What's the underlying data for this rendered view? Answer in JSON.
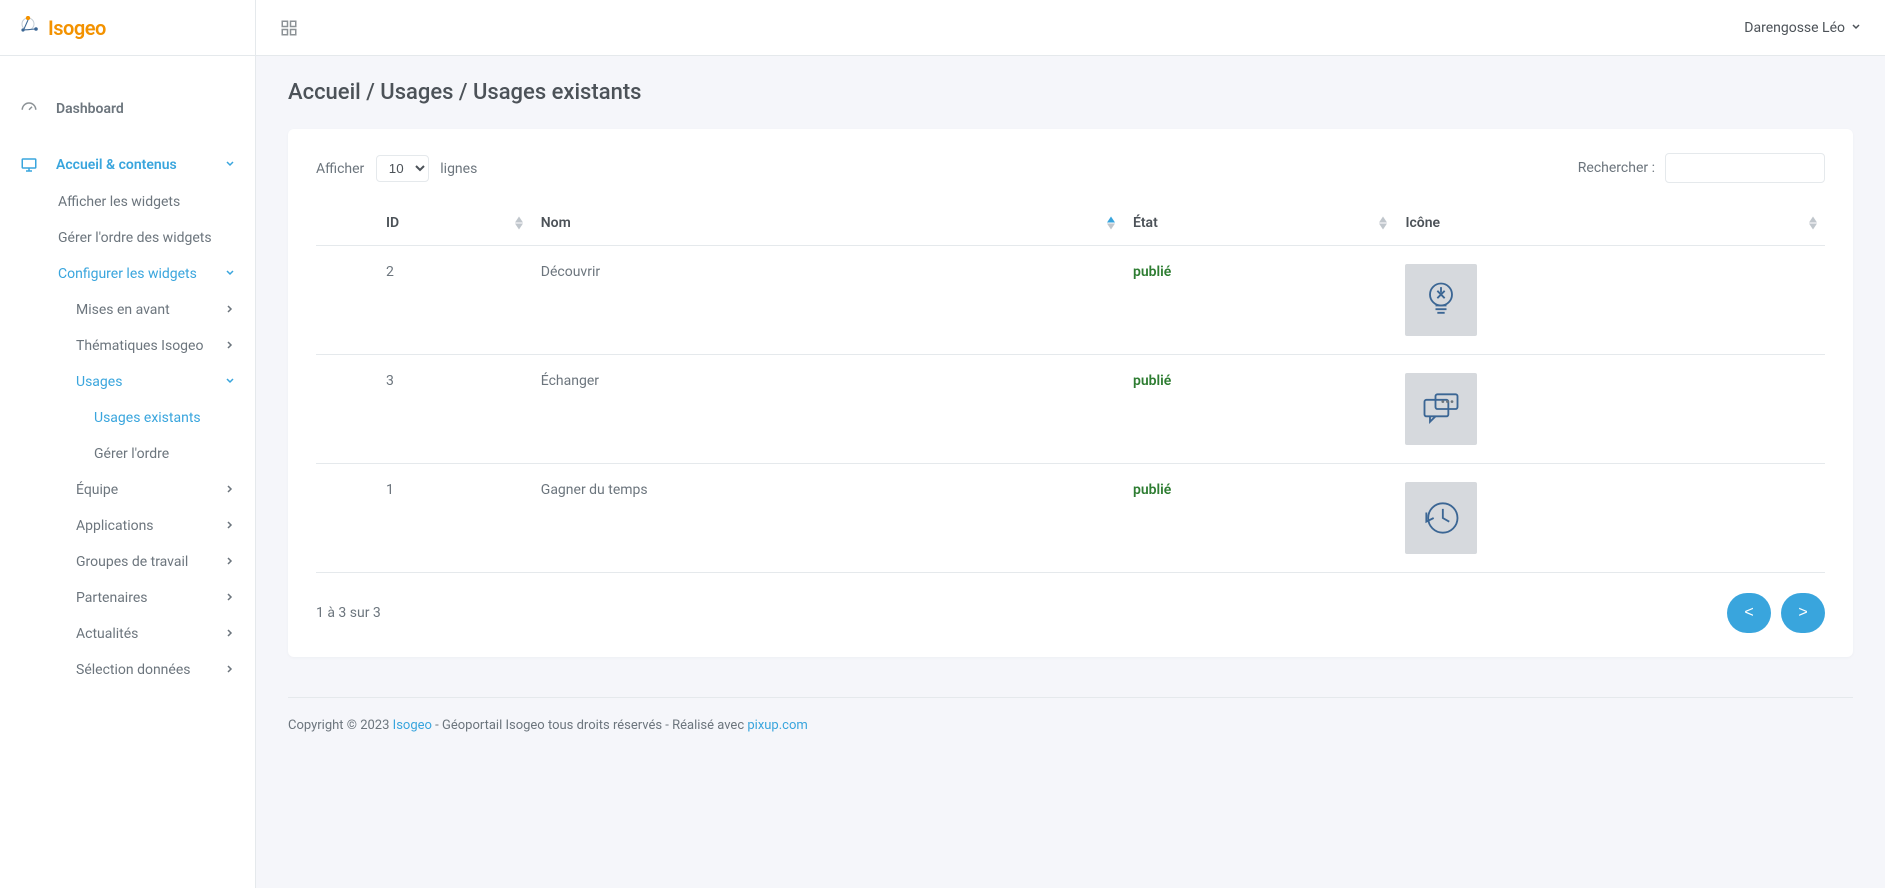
{
  "logo_text": "Isogeo",
  "topbar": {
    "user_name": "Darengosse Léo"
  },
  "sidebar": {
    "dashboard": "Dashboard",
    "accueil": "Accueil & contenus",
    "afficher_widgets": "Afficher les widgets",
    "gerer_ordre_widgets": "Gérer l'ordre des widgets",
    "configurer_widgets": "Configurer les widgets",
    "mises_en_avant": "Mises en avant",
    "thematiques_isogeo": "Thématiques Isogeo",
    "usages": "Usages",
    "usages_existants": "Usages existants",
    "gerer_ordre": "Gérer l'ordre",
    "equipe": "Équipe",
    "applications": "Applications",
    "groupes_travail": "Groupes de travail",
    "partenaires": "Partenaires",
    "actualites": "Actualités",
    "selection_donnees": "Sélection données"
  },
  "breadcrumb": "Accueil / Usages / Usages existants",
  "table": {
    "show_prefix": "Afficher",
    "show_suffix": "lignes",
    "page_size": "10",
    "search_label": "Rechercher :",
    "search_value": "",
    "cols": {
      "id": "ID",
      "nom": "Nom",
      "etat": "État",
      "icone": "Icône"
    },
    "rows": [
      {
        "id": "2",
        "nom": "Découvrir",
        "etat": "publié",
        "icon": "bulb"
      },
      {
        "id": "3",
        "nom": "Échanger",
        "etat": "publié",
        "icon": "chat"
      },
      {
        "id": "1",
        "nom": "Gagner du temps",
        "etat": "publié",
        "icon": "clock"
      }
    ],
    "info_text": "1 à 3 sur 3",
    "prev_label": "<",
    "next_label": ">"
  },
  "footer": {
    "copyright_prefix": "Copyright © 2023 ",
    "brand": "Isogeo",
    "middle": " - Géoportail Isogeo tous droits réservés - Réalisé avec ",
    "pixup": "pixup.com"
  }
}
